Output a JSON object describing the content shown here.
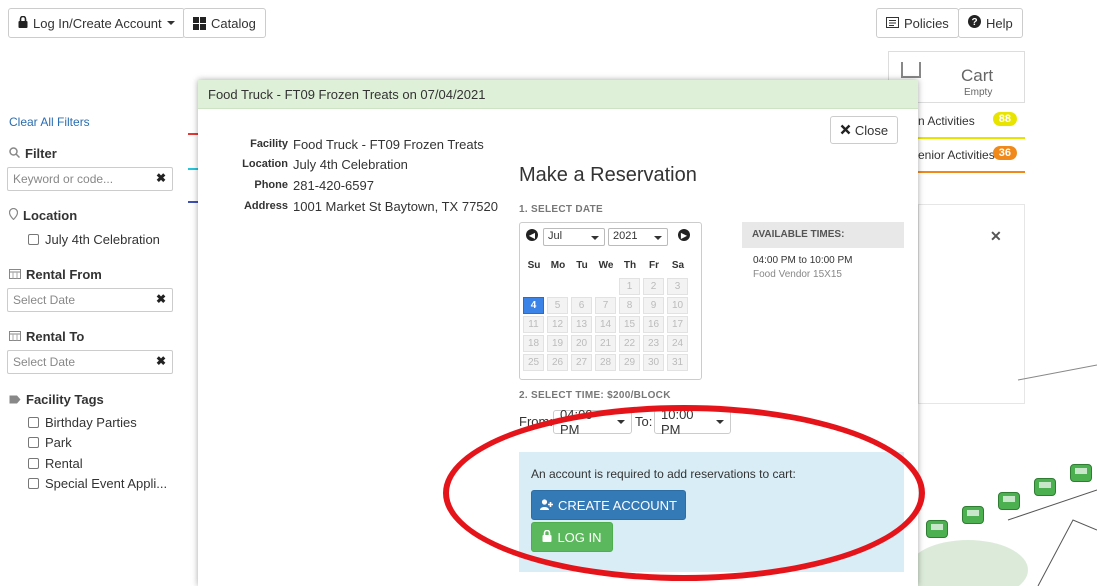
{
  "topbar": {
    "login_label": "Log In/Create Account",
    "catalog_label": "Catalog",
    "policies_label": "Policies",
    "help_label": "Help"
  },
  "sidebar": {
    "clear_filters": "Clear All Filters",
    "filter_heading": "Filter",
    "keyword_placeholder": "Keyword or code...",
    "location_heading": "Location",
    "location_options": [
      "July 4th Celebration"
    ],
    "rental_from_heading": "Rental From",
    "rental_from_placeholder": "Select Date",
    "rental_to_heading": "Rental To",
    "rental_to_placeholder": "Select Date",
    "tags_heading": "Facility Tags",
    "tags": [
      "Birthday Parties",
      "Park",
      "Rental",
      "Special Event Appli..."
    ]
  },
  "cart": {
    "title": "Cart",
    "status": "Empty"
  },
  "background_activities": [
    {
      "label": "n Activities",
      "count": "88",
      "color": "#e8e400"
    },
    {
      "label": "enior Activities",
      "count": "36",
      "color": "#f0891a"
    }
  ],
  "modal": {
    "header": "Food Truck - FT09 Frozen Treats on 07/04/2021",
    "close_label": "Close",
    "info": [
      {
        "label": "Facility",
        "value": "Food Truck - FT09 Frozen Treats"
      },
      {
        "label": "Location",
        "value": "July 4th Celebration"
      },
      {
        "label": "Phone",
        "value": "281-420-6597"
      },
      {
        "label": "Address",
        "value": "1001 Market St Baytown, TX 77520"
      }
    ],
    "title": "Make a Reservation",
    "step1": "1. SELECT DATE",
    "calendar": {
      "month": "Jul",
      "year": "2021",
      "weekdays": [
        "Su",
        "Mo",
        "Tu",
        "We",
        "Th",
        "Fr",
        "Sa"
      ],
      "selected_day": "4",
      "days": [
        "1",
        "2",
        "3",
        "4",
        "5",
        "6",
        "7",
        "8",
        "9",
        "10",
        "11",
        "12",
        "13",
        "14",
        "15",
        "16",
        "17",
        "18",
        "19",
        "20",
        "21",
        "22",
        "23",
        "24",
        "25",
        "26",
        "27",
        "28",
        "29",
        "30",
        "31"
      ]
    },
    "available_heading": "AVAILABLE TIMES:",
    "available_time": "04:00 PM to 10:00 PM",
    "available_sub": "Food Vendor 15X15",
    "step2": "2. SELECT TIME: $200/BLOCK",
    "from_label": "From:",
    "from_value": "04:00 PM",
    "to_label": "To:",
    "to_value": "10:00 PM",
    "account_msg": "An account is required to add reservations to cart:",
    "create_account": "CREATE ACCOUNT",
    "log_in": "LOG IN"
  }
}
